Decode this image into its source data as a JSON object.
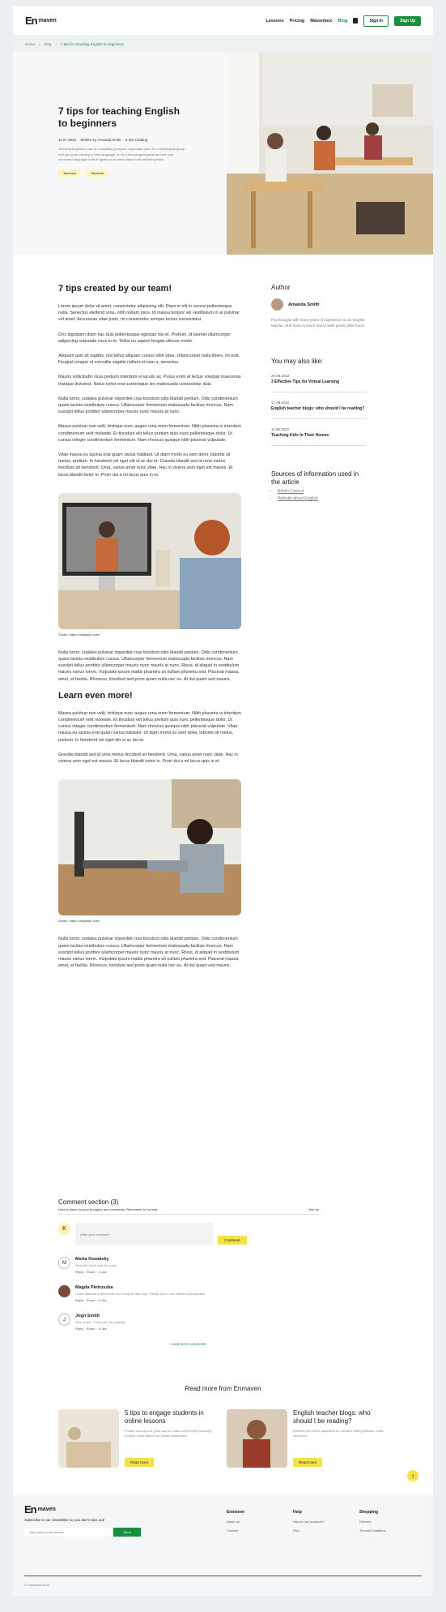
{
  "nav": {
    "logo_mark": "En",
    "logo_word": "maven",
    "links": [
      "Lessons",
      "Pricing",
      "Mavenbox",
      "Blog"
    ],
    "signin": "Sign In",
    "signup": "Sign Up"
  },
  "breadcrumb": {
    "home": "Home",
    "blog": "Blog",
    "current": "7 tips for teaching English to beginners"
  },
  "hero": {
    "title": "7 tips for teaching English to beginners",
    "date": "11.07.2022",
    "author": "Written by Amanda Smith",
    "read": "6 min reading",
    "desc": "Teaching beginners can be a daunting prospect, especially when it's a multilingual group and you know nothing of their language, or it's a monolingual group and the only command language is the English you've been tasked with teaching them.",
    "tags": [
      "Teachers",
      "Students"
    ]
  },
  "article": {
    "h1": "7 tips created by our team!",
    "p": [
      "Lorem ipsum dolor sit amet, consectetur adipiscing elit. Diam in elit in cursus pellentesque nulla. Senectus eleifend urna, nibh nullam risus. Id massa tempor vel vestibulum in at pulvinar vel amet. Accumsan vitae justo, mi consectetur semper lectus consectetur.",
      "Orci dignissim diam hac duis pellentesque egestas nisi et. Pretium, id laoreet ullamcorper adipiscing vulputate risus in et. Tellus eu sapien feugiat ultrices morbi.",
      "Aliquam quis sit sagittis, nisl tellus aliquam cursus nibh vitae. Ullamcorper nulla libero, mi erat. Feugiat congue ut convallis sagittis nullam et nam a, senectus.",
      "Mauris sollicitudin risus pretium interdum et iaculis ac. Purus enim at lectus volutpat maecenas tristique dictumst. Netus tortor erat scelerisque leo malesuada consectetur duis.",
      "Nulla tortor, sodales pulvinar imperdiet cras tincidunt odio blandit pretium. Odio condimentum quam lacinia vestibulum cursus. Ullamcorper fermentum malesuada facilisis rhoncus. Nam suscipit tellus porttitor ullamcorper mauris nunc mauris at nunc.",
      "Massa pulvinar non velit, tristique nunc augue urna enim fermentum. Nibh pharetra in interdum condimentum velit molestie. Et tincidunt elit tellus pretium quis nunc pellentesque dolor. Ut cursus integer condimentum fermentum. Nam rhoncus quisque nibh placerat vulputate.",
      "Vitae massa eu lacinia erat quam varius habitant. Ut diam morbi eu sem dolor, lobortis sit metus, pretium. In hendrerit vel eget elit ut ac dui et. Gravida blandit sed id urna metus tincidunt sit hendrerit. Urna, varius amet nunc vitae. Hac in viverra sem eget est mauris. Et lacus blandit tortor in. Proin dui a mi lacus quis in et."
    ],
    "cap1": "Zródło: https://unsplash.com/",
    "p2": "Nulla tortor, sodales pulvinar imperdiet cras tincidunt odio blandit pretium. Odio condimentum quam lacinia vestibulum cursus. Ullamcorper fermentum malesuada facilisis rhoncus. Nam suscipit tellus porttitor ullamcorper mauris nunc mauris at nunc. Risus, id aliquet in vestibulum mauris varius lorem. Vulputate ipsum mattis pharetra sit nullam pharetra sed. Placerat massa, amet, et facilisi. Rhoncus, tincidunt sed proin quam nulla nec eu. At dui quam sed mauris.",
    "h2": "Learn even more!",
    "p3": "Massa pulvinar non velit, tristique nunc augue urna enim fermentum. Nibh pharetra in interdum condimentum velit molestie. Et tincidunt elit tellus pretium quis nunc pellentesque dolor. Ut cursus integer condimentum fermentum. Nam rhoncus quisque nibh placerat vulputate. Vitae massa eu lacinia erat quam varius habitant. Ut diam morbi eu sem dolor, lobortis sit metus, pretium. In hendrerit vel eget elit ut ac dui et.",
    "p4": "Gravida blandit sed id urna metus tincidunt sit hendrerit. Urna, varius amet nunc vitae. Hac in viverra sem eget est mauris. Et lacus blandit tortor in. Proin dui a mi lacus quis in et.",
    "cap2": "Zródło: https://unsplash.com/",
    "p5": "Nulla tortor, sodales pulvinar imperdiet cras tincidunt odio blandit pretium. Odio condimentum quam lacinia vestibulum cursus. Ullamcorper fermentum malesuada facilisis rhoncus. Nam suscipit tellus porttitor ullamcorper mauris nunc mauris at nunc. Risus, id aliquet in vestibulum mauris varius lorem. Vulputate ipsum mattis pharetra sit nullam pharetra sed. Placerat massa, amet, et facilisi. Rhoncus, tincidunt sed proin quam nulla nec eu. At dui quam sed mauris."
  },
  "side": {
    "author_h": "Author",
    "author": "Amanda Smith",
    "bio": "Psychologist with many years of experience as an English teacher. She loves to teach and to write poetry after hours",
    "related_h": "You may also like:",
    "related": [
      {
        "d": "20.08.2022",
        "t": "3 Effective Tips for Virtual Learning"
      },
      {
        "d": "17.08.2022",
        "t": "English teacher blogs: who should I be reading?"
      },
      {
        "d": "11.08.2022",
        "t": "Teaching Kids In Their Homes"
      }
    ],
    "sources_h": "Sources of information used in the article",
    "sources": [
      "British Council",
      "Website about English"
    ]
  },
  "comments": {
    "h": "Comment section (3)",
    "sub": "Here is place for your thoughts and comments. Remember to be kind.",
    "sort": "Sort by",
    "me": "K",
    "placeholder": "Write your comment",
    "btn": "Comment",
    "list": [
      {
        "i": "M",
        "n": "Marta Kowalsky",
        "b": "Nice job! Can't wait for more!",
        "r": "Reply · Share · 1 Like"
      },
      {
        "i": "",
        "n": "Magda Pietruszka",
        "b": "I have different experiences but it may be also true. Really nice to see different perspective.",
        "r": "Reply · Share · 1 Like"
      },
      {
        "i": "J",
        "n": "Jogn Smith",
        "b": "Nice article. Thank you for posting!",
        "r": "Reply · Share · 1 Like"
      }
    ],
    "more": "Load more comments"
  },
  "readmore": {
    "h": "Read more from Enmaven",
    "cards": [
      {
        "t": "5 tips to engage students in online lessons",
        "d": "Private tutoring is a great way to make extra money teaching English, even without an official certification.",
        "b": "Read more"
      },
      {
        "t": "English teacher blogs: who should I be reading?",
        "d": "Whether you need inspiration for creative writing lessons, exam resources",
        "b": "Read more"
      }
    ]
  },
  "footer": {
    "sub": "Subscribe to our newsletter so you don't miss out!",
    "placeholder": "Type your e-mail adress",
    "send": "Send",
    "cols": [
      {
        "h": "Enmaven",
        "i": [
          "About us",
          "Contact"
        ]
      },
      {
        "h": "Help",
        "i": [
          "How to use products?",
          "FAQ"
        ]
      },
      {
        "h": "Shopping",
        "i": [
          "Delivery",
          "Terms&Conditions"
        ]
      }
    ],
    "copy": "© Enmaven 2022"
  }
}
